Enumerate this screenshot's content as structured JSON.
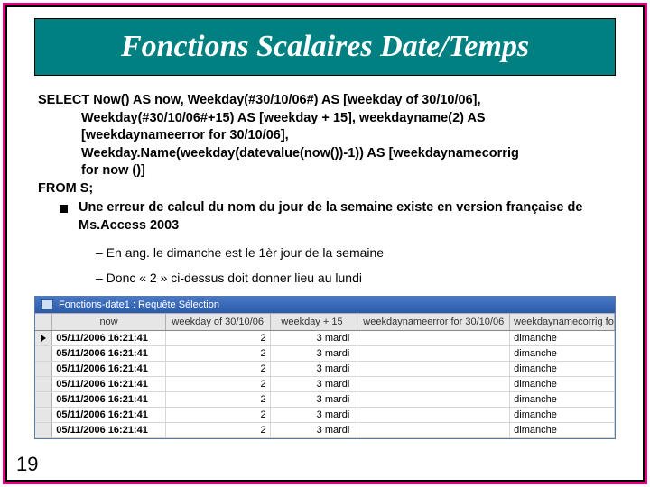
{
  "slide": {
    "title": "Fonctions Scalaires Date/Temps",
    "number": "19"
  },
  "sql": {
    "l1": "SELECT Now() AS now, Weekday(#30/10/06#) AS [weekday of 30/10/06],",
    "l2": "Weekday(#30/10/06#+15) AS [weekday + 15], weekdayname(2) AS",
    "l3": "[weekdaynameerror for 30/10/06],",
    "l4": "Weekday.Name(weekday(datevalue(now())-1)) AS [weekdaynamecorrig",
    "l5": "for now ()]",
    "l6": "FROM S;"
  },
  "bullet": "Une erreur de calcul du nom du jour de la semaine existe en version française de Ms.Access 2003",
  "sub1": "–  En ang. le dimanche est le 1èr jour de la semaine",
  "sub2": "–  Donc « 2 » ci-dessus doit donner lieu au lundi",
  "query": {
    "title": "Fonctions-date1 : Requête Sélection",
    "headers": {
      "now": "now",
      "wk": "weekday of 30/10/06",
      "wk15": "weekday + 15",
      "err": "weekdaynameerror for 30/10/06",
      "corr": "weekdaynamecorrig for now ()"
    },
    "rows": [
      {
        "now": "05/11/2006 16:21:41",
        "wk": "2",
        "wk15": "3 mardi",
        "err": "",
        "corr": "dimanche"
      },
      {
        "now": "05/11/2006 16:21:41",
        "wk": "2",
        "wk15": "3 mardi",
        "err": "",
        "corr": "dimanche"
      },
      {
        "now": "05/11/2006 16:21:41",
        "wk": "2",
        "wk15": "3 mardi",
        "err": "",
        "corr": "dimanche"
      },
      {
        "now": "05/11/2006 16:21:41",
        "wk": "2",
        "wk15": "3 mardi",
        "err": "",
        "corr": "dimanche"
      },
      {
        "now": "05/11/2006 16:21:41",
        "wk": "2",
        "wk15": "3 mardi",
        "err": "",
        "corr": "dimanche"
      },
      {
        "now": "05/11/2006 16:21:41",
        "wk": "2",
        "wk15": "3 mardi",
        "err": "",
        "corr": "dimanche"
      },
      {
        "now": "05/11/2006 16:21:41",
        "wk": "2",
        "wk15": "3 mardi",
        "err": "",
        "corr": "dimanche"
      }
    ]
  }
}
